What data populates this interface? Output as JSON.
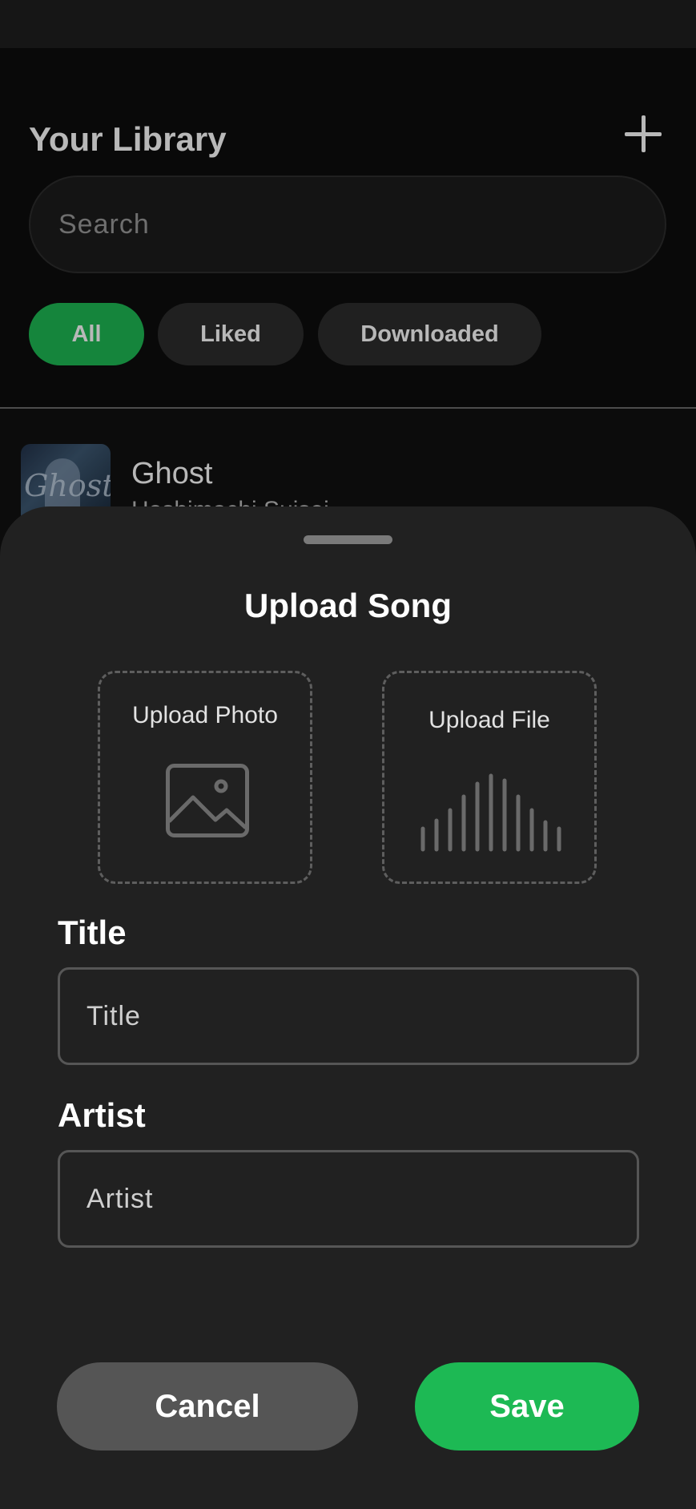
{
  "library": {
    "title": "Your Library",
    "add_icon": "plus-icon",
    "search": {
      "placeholder": "Search"
    },
    "filters": [
      {
        "label": "All",
        "active": true
      },
      {
        "label": "Liked",
        "active": false
      },
      {
        "label": "Downloaded",
        "active": false
      }
    ],
    "songs": [
      {
        "title": "Ghost",
        "artist": "Hoshimachi Suisei",
        "art_text": "Ghost"
      }
    ]
  },
  "upload_sheet": {
    "title": "Upload Song",
    "upload_photo": {
      "label": "Upload Photo",
      "icon": "image-icon"
    },
    "upload_file": {
      "label": "Upload File",
      "icon": "audio-wave-icon"
    },
    "title_field": {
      "label": "Title",
      "placeholder": "Title",
      "value": ""
    },
    "artist_field": {
      "label": "Artist",
      "placeholder": "Artist",
      "value": ""
    },
    "cancel_label": "Cancel",
    "save_label": "Save"
  },
  "colors": {
    "accent": "#1db954",
    "background": "#0c0c0c",
    "sheet": "#212121",
    "chip": "#2c2c2c",
    "cancel_button": "#555555"
  }
}
